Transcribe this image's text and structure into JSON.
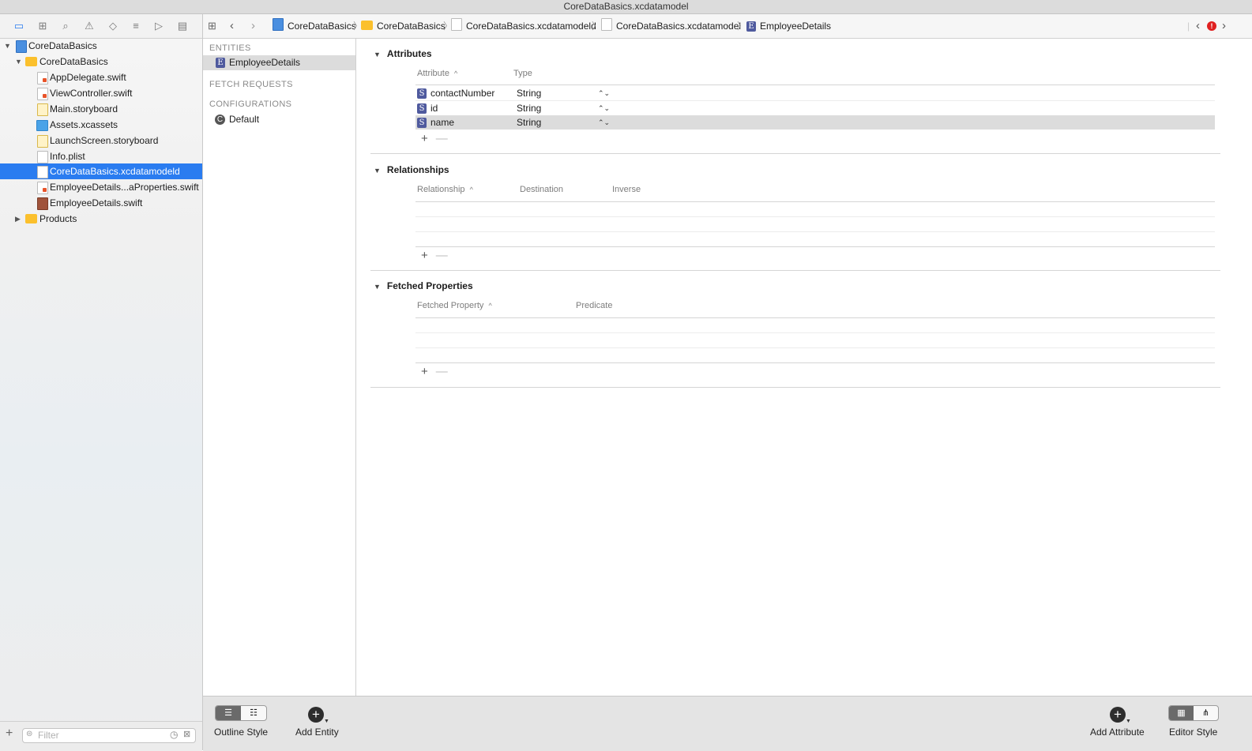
{
  "window": {
    "title": "CoreDataBasics.xcdatamodel"
  },
  "navigator": {
    "toolbar_icons": [
      "folder-icon",
      "hierarchy-icon",
      "search-icon",
      "warning-icon",
      "test-diamond-icon",
      "debug-list-icon",
      "breakpoint-icon",
      "report-icon"
    ],
    "tree": [
      {
        "label": "CoreDataBasics",
        "icon": "project-icon"
      },
      {
        "label": "CoreDataBasics",
        "icon": "folder-icon"
      },
      {
        "label": "AppDelegate.swift",
        "icon": "swift-file-icon"
      },
      {
        "label": "ViewController.swift",
        "icon": "swift-file-icon"
      },
      {
        "label": "Main.storyboard",
        "icon": "storyboard-icon"
      },
      {
        "label": "Assets.xcassets",
        "icon": "assets-icon"
      },
      {
        "label": "LaunchScreen.storyboard",
        "icon": "storyboard-icon"
      },
      {
        "label": "Info.plist",
        "icon": "plist-icon"
      },
      {
        "label": "CoreDataBasics.xcdatamodeld",
        "icon": "datamodel-icon"
      },
      {
        "label": "EmployeeDetails...aProperties.swift",
        "icon": "swift-file-icon"
      },
      {
        "label": "EmployeeDetails.swift",
        "icon": "swift-file-icon"
      },
      {
        "label": "Products",
        "icon": "folder-icon"
      }
    ],
    "filter_placeholder": "Filter"
  },
  "jumpbar": {
    "crumbs": [
      "CoreDataBasics",
      "CoreDataBasics",
      "CoreDataBasics.xcdatamodeld",
      "CoreDataBasics.xcdatamodel",
      "EmployeeDetails"
    ],
    "error_badge": "!"
  },
  "entities_pane": {
    "entities_header": "ENTITIES",
    "entity": "EmployeeDetails",
    "entity_badge": "E",
    "fetch_header": "FETCH REQUESTS",
    "config_header": "CONFIGURATIONS",
    "config": "Default",
    "config_badge": "C"
  },
  "attributes": {
    "title": "Attributes",
    "col_attribute": "Attribute",
    "col_type": "Type",
    "rows": [
      {
        "badge": "S",
        "name": "contactNumber",
        "type": "String"
      },
      {
        "badge": "S",
        "name": "id",
        "type": "String"
      },
      {
        "badge": "S",
        "name": "name",
        "type": "String"
      }
    ]
  },
  "relationships": {
    "title": "Relationships",
    "col_relationship": "Relationship",
    "col_destination": "Destination",
    "col_inverse": "Inverse"
  },
  "fetched_properties": {
    "title": "Fetched Properties",
    "col_fetched": "Fetched Property",
    "col_predicate": "Predicate"
  },
  "bottom": {
    "outline_style": "Outline Style",
    "add_entity": "Add Entity",
    "add_attribute": "Add Attribute",
    "editor_style": "Editor Style"
  },
  "glyphs": {
    "plus": "+",
    "minus": "—",
    "sort": "^",
    "stepper": "⌃⌄"
  }
}
